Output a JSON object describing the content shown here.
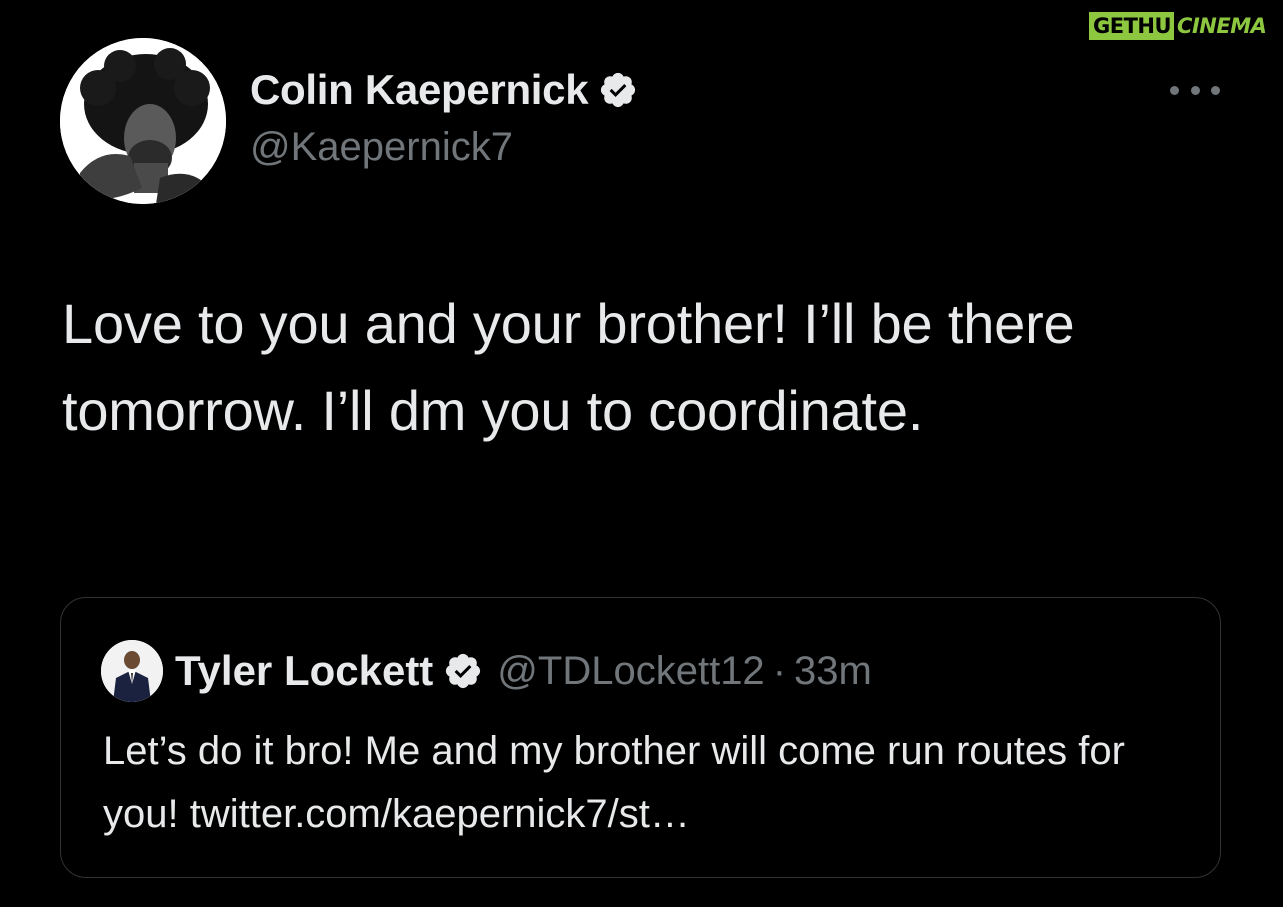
{
  "watermark": {
    "part1": "GETHU",
    "part2": "CINEMA",
    "color": "#8dc63f"
  },
  "tweet": {
    "author": {
      "name": "Colin Kaepernick",
      "handle": "@Kaepernick7",
      "verified": true
    },
    "more_icon": "more-horizontal-icon",
    "text": "Love to you and your brother! I’ll be there tomorrow. I’ll dm you to coordinate."
  },
  "quoted_tweet": {
    "author": {
      "name": "Tyler Lockett",
      "handle": "@TDLockett12",
      "verified": true
    },
    "separator": "·",
    "time": "33m",
    "text": "Let’s do it bro! Me and my brother will come run routes for you! twitter.com/kaepernick7/st…"
  },
  "colors": {
    "background": "#000000",
    "primary_text": "#e7e9ea",
    "secondary_text": "#71767b",
    "border": "#2f3336",
    "verified_badge": "#e7e9ea"
  }
}
